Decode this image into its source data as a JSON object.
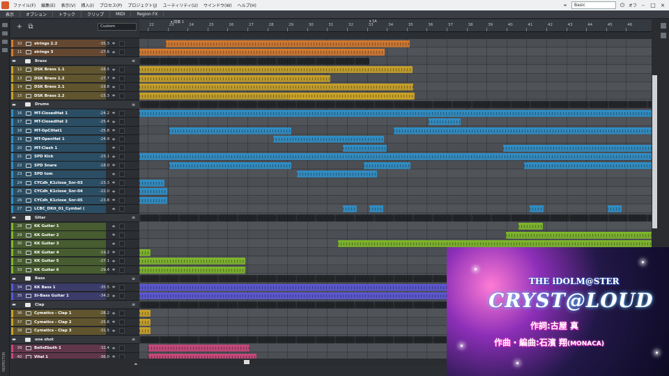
{
  "menu": {
    "items": [
      "ファイル(F)",
      "編集(E)",
      "表示(V)",
      "挿入(I)",
      "プロセス(P)",
      "プロジェクト(J)",
      "ユーティリティ(U)",
      "ウインドウ(W)",
      "ヘルプ(H)"
    ],
    "workspace": "Basic",
    "off_label": "オフ"
  },
  "viewbar": {
    "items": [
      "表示",
      "オプション",
      "トラック",
      "クリップ",
      "MIDI",
      "Region FX"
    ]
  },
  "tracklist": {
    "preset": "Custom",
    "tracks": [
      {
        "num": "10",
        "name": "strings 2.2",
        "vol": "-35.3",
        "color": "#d67a2e",
        "type": "synth"
      },
      {
        "num": "11",
        "name": "strings 3",
        "vol": "-27.6",
        "color": "#d67a2e",
        "type": "synth"
      },
      {
        "num": "",
        "name": "Brass",
        "vol": "",
        "color": "#3a3d42",
        "type": "folder"
      },
      {
        "num": "12",
        "name": "DSK Brass 1.1",
        "vol": "-16.5",
        "color": "#c9a227",
        "type": "synth"
      },
      {
        "num": "13",
        "name": "DSK Brass 1.2",
        "vol": "-27.7",
        "color": "#c9a227",
        "type": "synth"
      },
      {
        "num": "14",
        "name": "DSK Brass 2.1",
        "vol": "-19.8",
        "color": "#c9a227",
        "type": "synth"
      },
      {
        "num": "15",
        "name": "DSK Brass 2.2",
        "vol": "-15.3",
        "color": "#c9a227",
        "type": "synth"
      },
      {
        "num": "",
        "name": "Drums",
        "vol": "",
        "color": "#3a3d42",
        "type": "folder"
      },
      {
        "num": "16",
        "name": "MT-ClosedHat 1",
        "vol": "-24.2",
        "color": "#2f8fc7",
        "type": "synth"
      },
      {
        "num": "17",
        "name": "MT-ClosedHat 2",
        "vol": "-25.4",
        "color": "#2f8fc7",
        "type": "synth"
      },
      {
        "num": "18",
        "name": "MT-OpClHat1",
        "vol": "-25.8",
        "color": "#2f8fc7",
        "type": "synth"
      },
      {
        "num": "19",
        "name": "MT-OpenHat 1",
        "vol": "-24.9",
        "color": "#2f8fc7",
        "type": "synth"
      },
      {
        "num": "20",
        "name": "MT-Clash 1",
        "vol": "",
        "color": "#2f8fc7",
        "type": "synth"
      },
      {
        "num": "21",
        "name": "SPD Kick",
        "vol": "-23.1",
        "color": "#2f8fc7",
        "type": "synth"
      },
      {
        "num": "22",
        "name": "SPD Snare",
        "vol": "-18.0",
        "color": "#2f8fc7",
        "type": "synth"
      },
      {
        "num": "23",
        "name": "SPD tom",
        "vol": "",
        "color": "#2f8fc7",
        "type": "synth"
      },
      {
        "num": "24",
        "name": "CYCdh_K1close_Snr-03",
        "vol": "-23.3",
        "color": "#2f8fc7",
        "type": "audio"
      },
      {
        "num": "25",
        "name": "CYCdh_K1close_Snr-04",
        "vol": "-22.0",
        "color": "#2f8fc7",
        "type": "audio"
      },
      {
        "num": "26",
        "name": "CYCdh_K1close_Snr-05",
        "vol": "-23.8",
        "color": "#2f8fc7",
        "type": "audio"
      },
      {
        "num": "27",
        "name": "LCBC_DKit_01_Cymbal (",
        "vol": "",
        "color": "#2f8fc7",
        "type": "audio"
      },
      {
        "num": "",
        "name": "Gitar",
        "vol": "",
        "color": "#3a3d42",
        "type": "folder"
      },
      {
        "num": "28",
        "name": "KK Guitar 1",
        "vol": "",
        "color": "#7fb82a",
        "type": "synth"
      },
      {
        "num": "29",
        "name": "KK Guitar 2",
        "vol": "",
        "color": "#7fb82a",
        "type": "synth"
      },
      {
        "num": "30",
        "name": "KK Guitar 3",
        "vol": "",
        "color": "#7fb82a",
        "type": "synth"
      },
      {
        "num": "31",
        "name": "KK Guitar 4",
        "vol": "-19.2",
        "color": "#7fb82a",
        "type": "synth"
      },
      {
        "num": "32",
        "name": "KK Guitar 5",
        "vol": "-27.1",
        "color": "#7fb82a",
        "type": "synth"
      },
      {
        "num": "33",
        "name": "KK Guitar 6",
        "vol": "-29.4",
        "color": "#7fb82a",
        "type": "synth"
      },
      {
        "num": "",
        "name": "Bass",
        "vol": "",
        "color": "#3a3d42",
        "type": "folder"
      },
      {
        "num": "34",
        "name": "KK Bass 1",
        "vol": "-35.5",
        "color": "#5b57d6",
        "type": "synth"
      },
      {
        "num": "35",
        "name": "SI-Bass Guitar 1",
        "vol": "-34.2",
        "color": "#5b57d6",
        "type": "synth"
      },
      {
        "num": "",
        "name": "Clap",
        "vol": "",
        "color": "#3a3d42",
        "type": "folder"
      },
      {
        "num": "36",
        "name": "Cymatics - Clap 1",
        "vol": "-28.2",
        "color": "#c9a227",
        "type": "audio"
      },
      {
        "num": "37",
        "name": "Cymatics - Clap 2",
        "vol": "-25.6",
        "color": "#c9a227",
        "type": "audio"
      },
      {
        "num": "38",
        "name": "Cymatics - Clap 3",
        "vol": "-31.5",
        "color": "#c9a227",
        "type": "audio"
      },
      {
        "num": "",
        "name": "one shot",
        "vol": "",
        "color": "#3a3d42",
        "type": "folder"
      },
      {
        "num": "39",
        "name": "BellsEbuth 1",
        "vol": "-32.4",
        "color": "#c9477a",
        "type": "synth"
      },
      {
        "num": "40",
        "name": "Vital 1",
        "vol": "-36.0",
        "color": "#c9477a",
        "type": "synth"
      }
    ]
  },
  "ruler": {
    "ticks": [
      "22",
      "23",
      "24",
      "25",
      "26",
      "27",
      "28",
      "29",
      "30",
      "31",
      "32",
      "33",
      "34",
      "35",
      "36",
      "37",
      "38",
      "39",
      "40",
      "41",
      "42",
      "43",
      "44",
      "45",
      "46"
    ],
    "markers": [
      "間奏 1",
      "1A"
    ]
  },
  "promo": {
    "brand": "THE iDOLM@STER",
    "title": "CRYST@LOUD",
    "credit_lyrics": "作詞:古屋 真",
    "credit_music": "作曲・編曲:石濱 翔",
    "credit_music_suffix": "(MONACA)"
  },
  "inspector_label": "INSPECTOR",
  "icons": [
    "plus-icon",
    "copy-icon",
    "scroll-up-icon",
    "scroll-down-icon"
  ]
}
